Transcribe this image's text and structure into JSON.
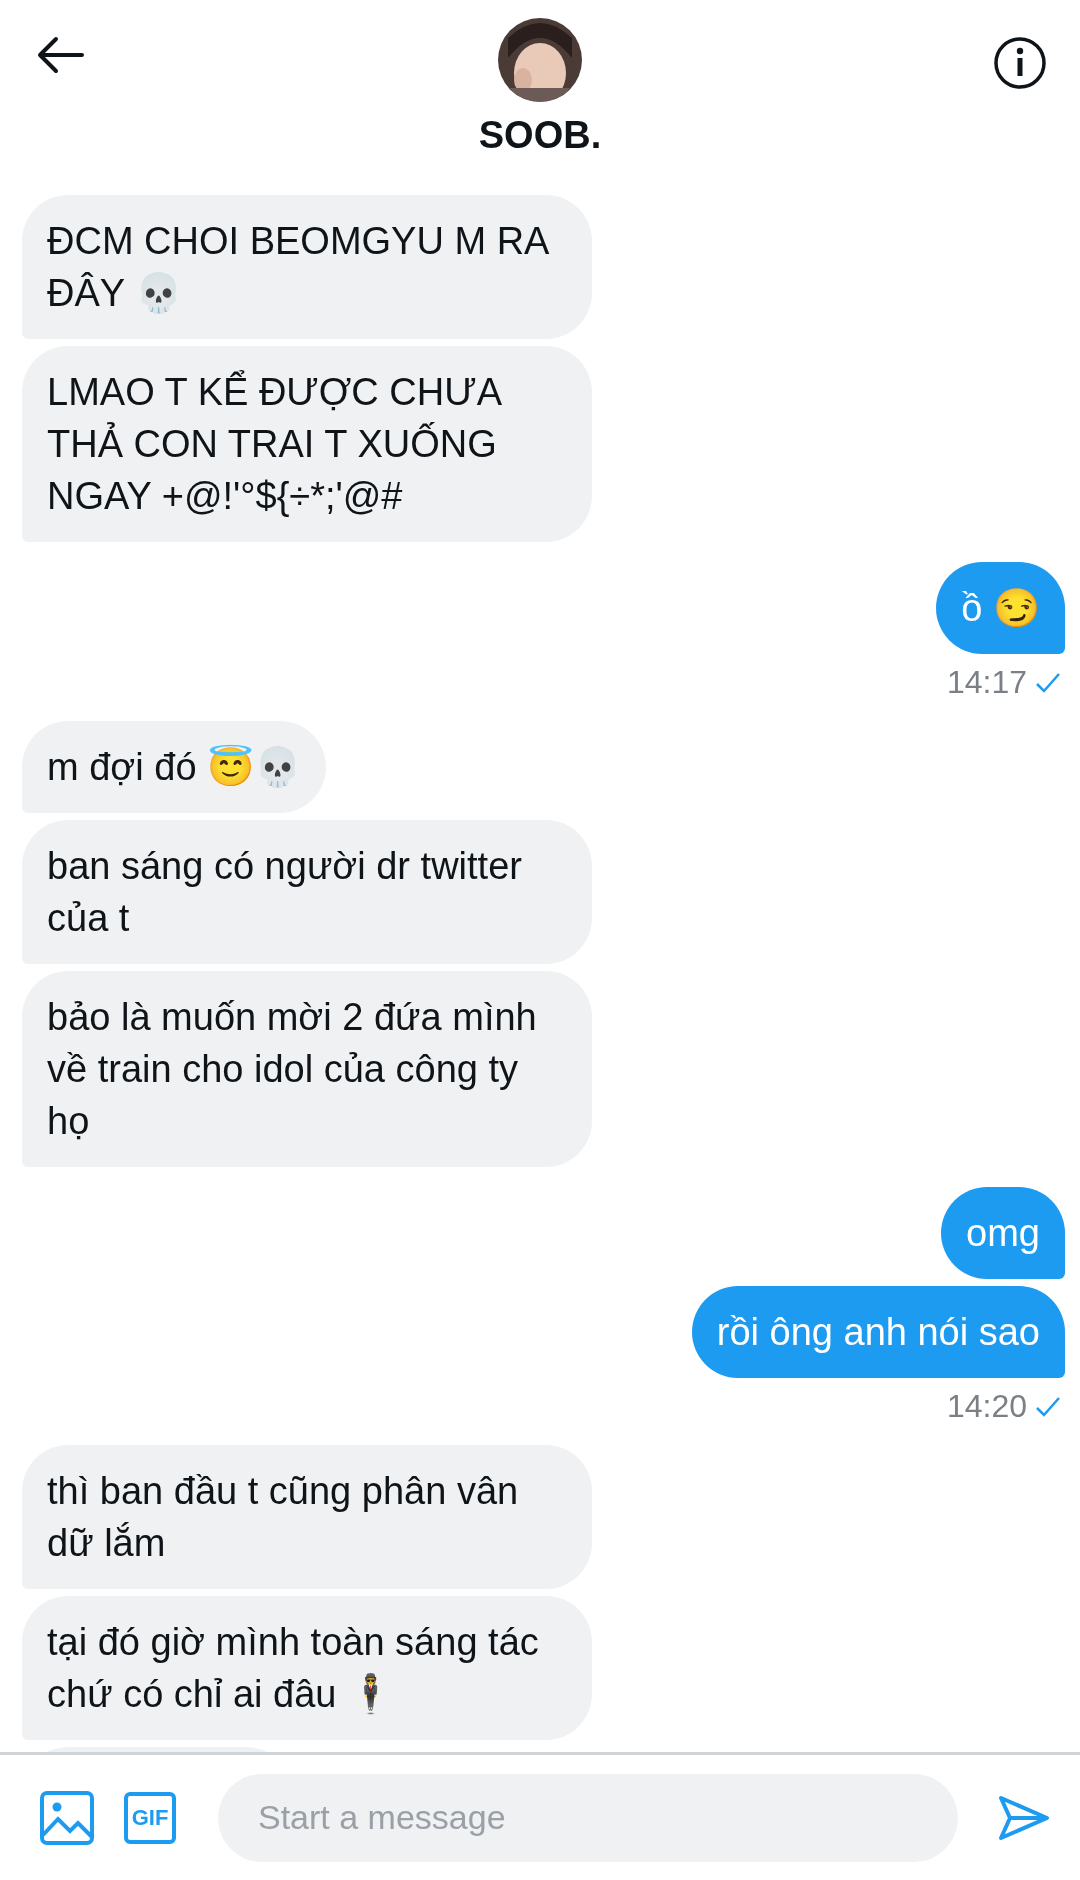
{
  "header": {
    "name": "SOOB."
  },
  "messages": [
    {
      "kind": "received",
      "text": "ĐCM CHOI BEOMGYU M RA ĐÂY 💀"
    },
    {
      "kind": "received",
      "text": "LMAO T KỂ ĐƯỢC CHƯA THẢ CON TRAI T XUỐNG NGAY +@!'°${÷*;'@#"
    },
    {
      "kind": "sent",
      "text": "ồ 😏"
    },
    {
      "kind": "timestamp",
      "text": "14:17",
      "seen": true
    },
    {
      "kind": "received",
      "text": "m đợi đó 😇💀"
    },
    {
      "kind": "received",
      "text": "ban sáng có người dr twitter của t"
    },
    {
      "kind": "received",
      "text": "bảo là muốn mời 2 đứa mình về train cho idol của công ty họ"
    },
    {
      "kind": "sent",
      "text": "omg"
    },
    {
      "kind": "sent",
      "text": "rồi ông anh nói sao"
    },
    {
      "kind": "timestamp",
      "text": "14:20",
      "seen": true
    },
    {
      "kind": "received",
      "text": "thì ban đầu t cũng phân vân dữ lắm"
    },
    {
      "kind": "received",
      "text": "tại đó giờ mình toàn sáng tác chứ có chỉ ai đâu 🕴"
    },
    {
      "kind": "clipped"
    }
  ],
  "composer": {
    "gif_label": "GIF",
    "placeholder": "Start a message"
  }
}
